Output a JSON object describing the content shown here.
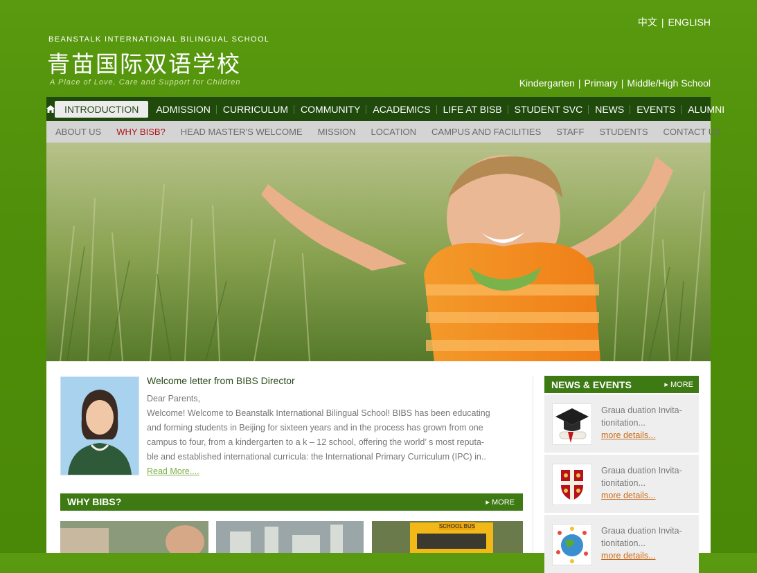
{
  "header": {
    "school_en": "BEANSTALK INTERNATIONAL BILINGUAL SCHOOL",
    "school_cn": "青苗国际双语学校",
    "tagline": "A Place of Love, Care and Support for Children",
    "lang_cn": "中文",
    "lang_en": "ENGLISH",
    "levels": [
      "Kindergarten",
      "Primary",
      "Middle/High School"
    ]
  },
  "main_nav": [
    "INTRODUCTION",
    "ADMISSION",
    "CURRICULUM",
    "COMMUNITY",
    "ACADEMICS",
    "LIFE AT BISB",
    "STUDENT SVC",
    "NEWS",
    "EVENTS",
    "ALUMNI"
  ],
  "sub_nav": [
    "ABOUT US",
    "WHY BISB?",
    "HEAD MASTER'S WELCOME",
    "MISSION",
    "LOCATION",
    "CAMPUS AND FACILITIES",
    "STAFF",
    "STUDENTS",
    "CONTACT US"
  ],
  "welcome": {
    "title": "Welcome letter from BIBS Director",
    "greeting": "Dear Parents,",
    "body_lines": [
      "Welcome! Welcome to Beanstalk International Bilingual School! BIBS has been educating",
      "and forming students in Beijing for sixteen years and in the process has grown from one",
      "campus to four, from a kindergarten to a k – 12 school, offering the world’  s most reputa-",
      "ble and established international curricula: the International Primary Curriculum (IPC) in.."
    ],
    "read_more": "Read More...."
  },
  "why": {
    "title": "WHY BIBS?",
    "more": "MORE",
    "thumb3_text": "SCHOOL BUS"
  },
  "news": {
    "title": "NEWS & EVENTS",
    "more": "MORE",
    "items": [
      {
        "line1": "Graua duation Invita-",
        "line2": "tionitation...",
        "link": "more details..."
      },
      {
        "line1": "Graua duation Invita-",
        "line2": "tionitation...",
        "link": "more details..."
      },
      {
        "line1": "Graua duation Invita-",
        "line2": "tionitation...",
        "link": "more details..."
      }
    ]
  },
  "colors": {
    "brand_green": "#4f8f0a",
    "nav_dark": "#1f4a0c",
    "bar_green": "#3e7a14",
    "highlight_red": "#b0141a"
  }
}
